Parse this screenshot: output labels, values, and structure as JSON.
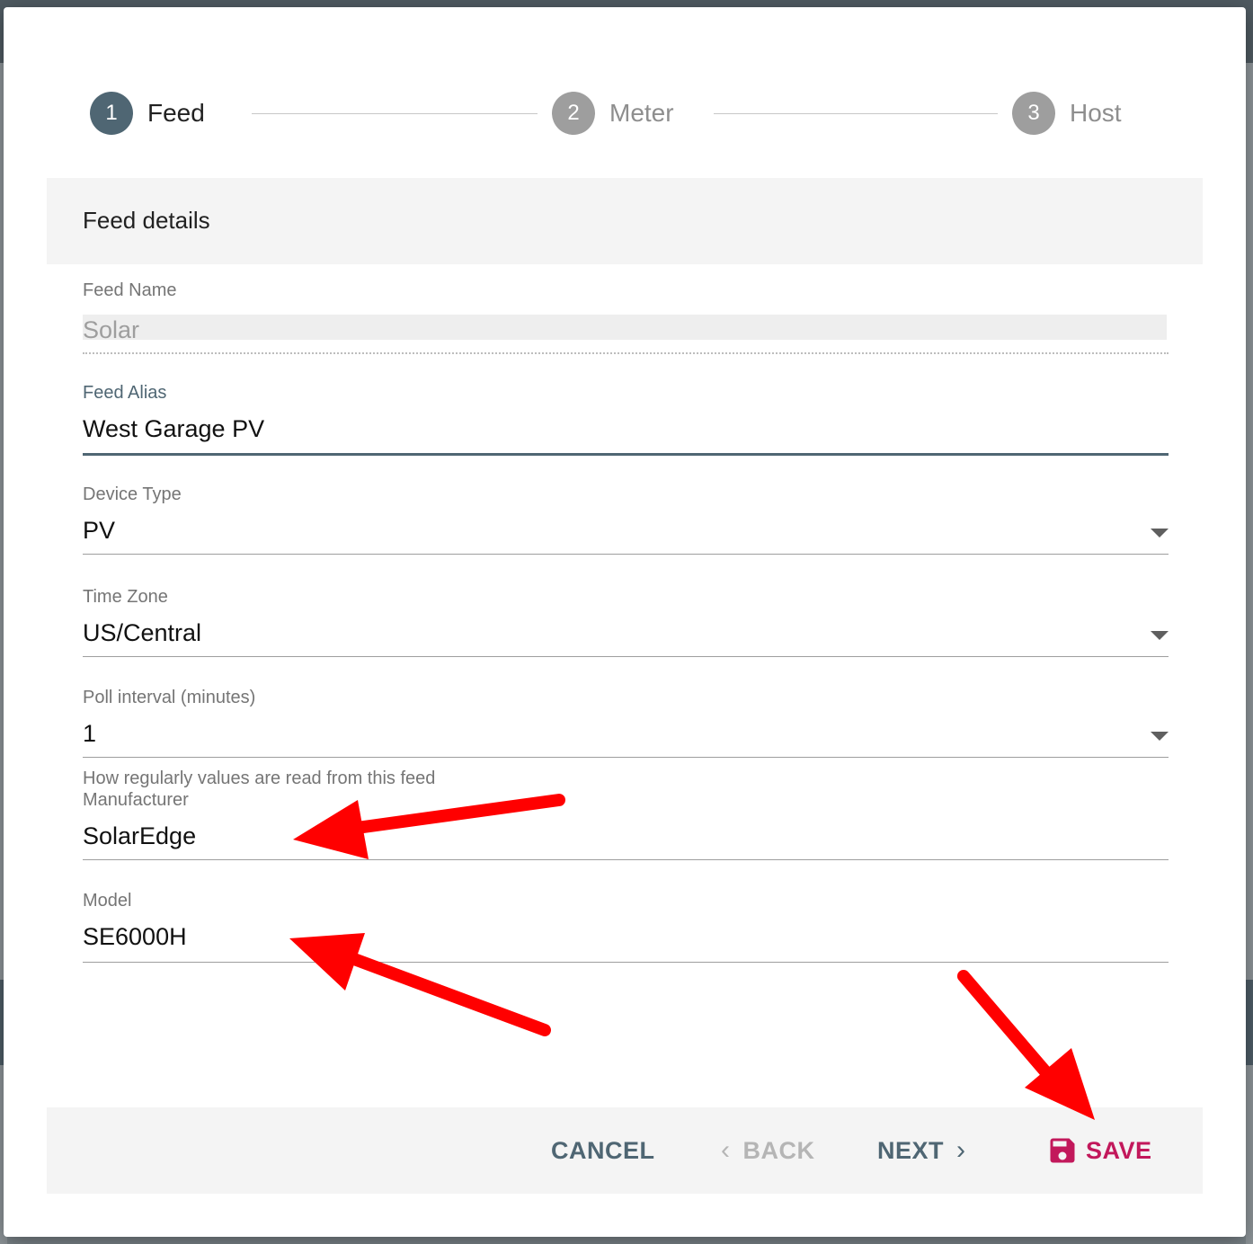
{
  "stepper": {
    "steps": [
      {
        "number": "1",
        "label": "Feed"
      },
      {
        "number": "2",
        "label": "Meter"
      },
      {
        "number": "3",
        "label": "Host"
      }
    ]
  },
  "section": {
    "title": "Feed details"
  },
  "fields": {
    "feed_name": {
      "label": "Feed Name",
      "value": "Solar"
    },
    "feed_alias": {
      "label": "Feed Alias",
      "value": "West Garage PV"
    },
    "device_type": {
      "label": "Device Type",
      "value": "PV"
    },
    "time_zone": {
      "label": "Time Zone",
      "value": "US/Central"
    },
    "poll_interval": {
      "label": "Poll interval (minutes)",
      "value": "1",
      "hint": "How regularly values are read from this feed"
    },
    "manufacturer": {
      "label": "Manufacturer",
      "value": "SolarEdge"
    },
    "model": {
      "label": "Model",
      "value": "SE6000H"
    }
  },
  "footer": {
    "cancel_label": "CANCEL",
    "back_label": "BACK",
    "next_label": "NEXT",
    "save_label": "SAVE"
  },
  "icons": {
    "back": "chevron-left-icon",
    "next": "chevron-right-icon",
    "save": "floppy-disk-icon",
    "dropdown": "caret-down-icon"
  },
  "colors": {
    "primary": "#4f6673",
    "save": "#c2185b",
    "annotation_arrow": "#ff0000",
    "disabled_text": "#b5b5b5"
  }
}
